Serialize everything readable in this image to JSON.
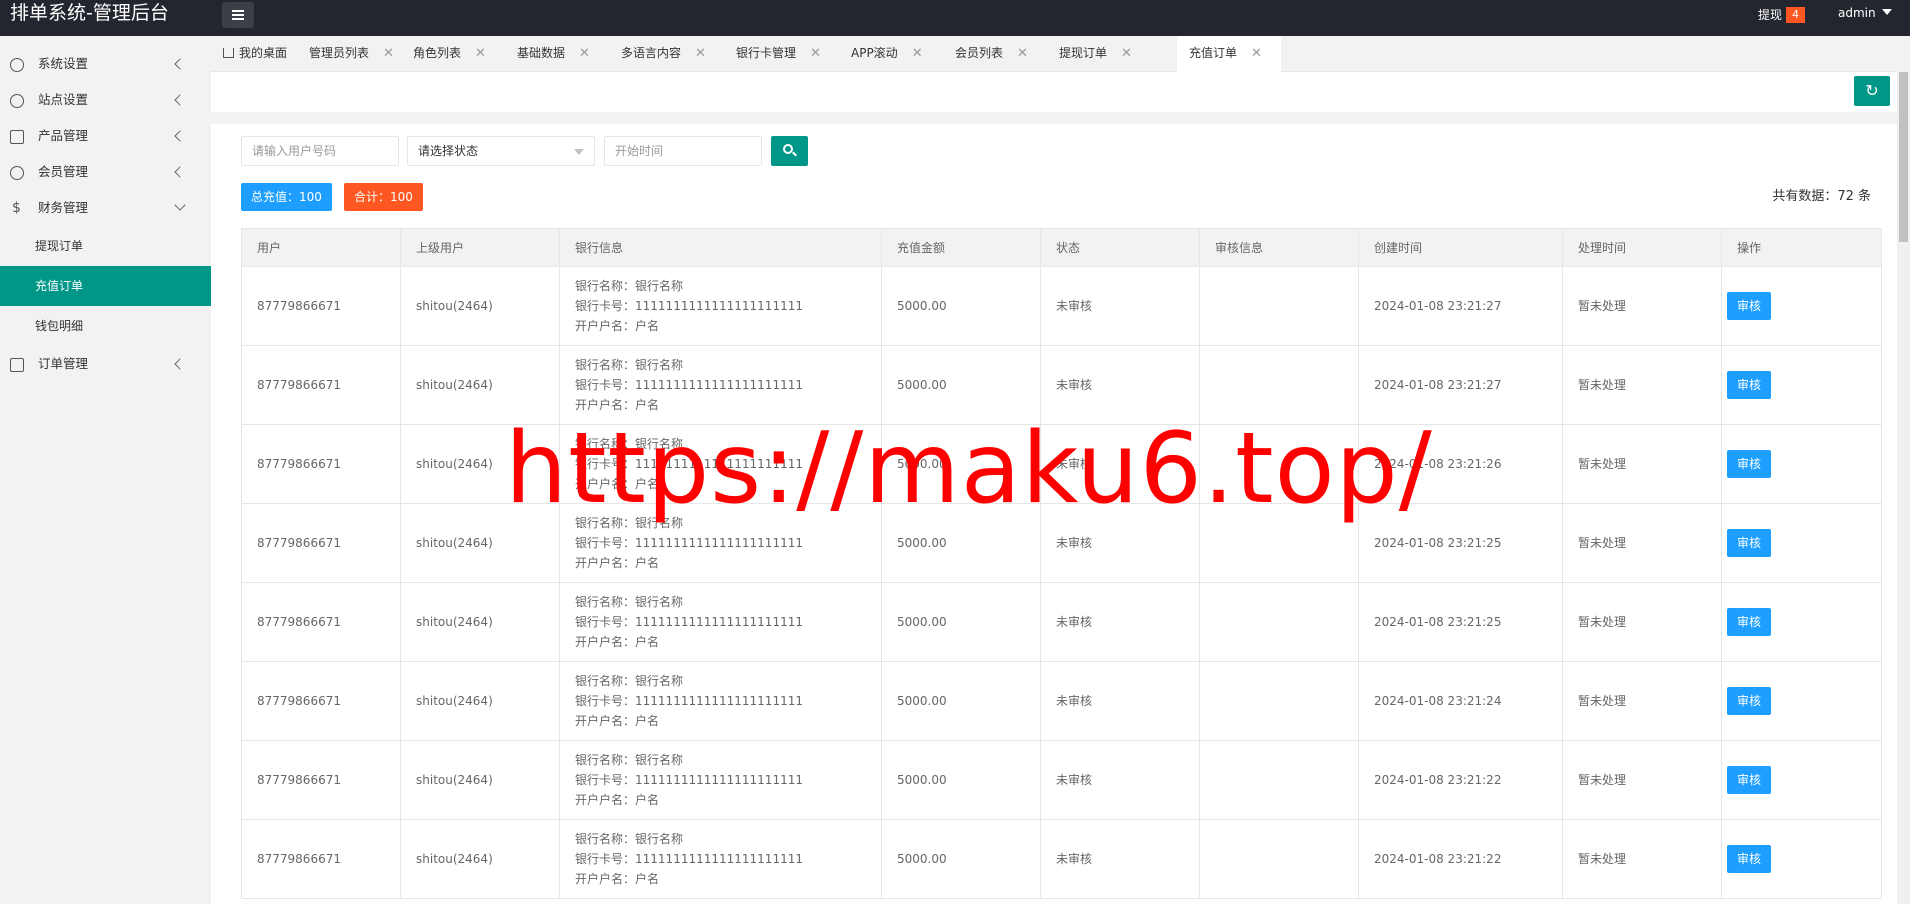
{
  "header": {
    "title": "排单系统-管理后台",
    "withdraw_label": "提现",
    "withdraw_count": "4",
    "user": "admin"
  },
  "sidebar": {
    "items": [
      {
        "label": "系统设置",
        "icon": "gear-icon"
      },
      {
        "label": "站点设置",
        "icon": "site-icon"
      },
      {
        "label": "产品管理",
        "icon": "product-icon"
      },
      {
        "label": "会员管理",
        "icon": "user-icon"
      },
      {
        "label": "财务管理",
        "icon": "dollar-icon"
      },
      {
        "label": "订单管理",
        "icon": "order-icon"
      }
    ],
    "sub_items": [
      "提现订单",
      "充值订单",
      "钱包明细"
    ]
  },
  "tabs": [
    "我的桌面",
    "管理员列表",
    "角色列表",
    "基础数据",
    "多语言内容",
    "银行卡管理",
    "APP滚动",
    "会员列表",
    "提现订单",
    "充值订单"
  ],
  "filters": {
    "user_placeholder": "请输入用户号码",
    "status_placeholder": "请选择状态",
    "start_time_placeholder": "开始时间"
  },
  "summary": {
    "total_recharge": "总充值：100",
    "sum": "合计：100",
    "count": "共有数据：72 条"
  },
  "table": {
    "headers": [
      "用户",
      "上级用户",
      "银行信息",
      "充值金额",
      "状态",
      "审核信息",
      "创建时间",
      "处理时间",
      "操作"
    ],
    "bank_labels": {
      "name": "银行名称：",
      "card": "银行卡号：",
      "holder": "开户户名："
    },
    "action_label": "审核",
    "rows": [
      {
        "user": "87779866671",
        "parent": "shitou(2464)",
        "bank_name": "银行名称",
        "card": "1111111111111111111111",
        "holder": "户名",
        "amount": "5000.00",
        "status": "未审核",
        "review": "",
        "created": "2024-01-08 23:21:27",
        "processed": "暂未处理"
      },
      {
        "user": "87779866671",
        "parent": "shitou(2464)",
        "bank_name": "银行名称",
        "card": "1111111111111111111111",
        "holder": "户名",
        "amount": "5000.00",
        "status": "未审核",
        "review": "",
        "created": "2024-01-08 23:21:27",
        "processed": "暂未处理"
      },
      {
        "user": "87779866671",
        "parent": "shitou(2464)",
        "bank_name": "银行名称",
        "card": "1111111111111111111111",
        "holder": "户名",
        "amount": "5000.00",
        "status": "未审核",
        "review": "",
        "created": "2024-01-08 23:21:26",
        "processed": "暂未处理"
      },
      {
        "user": "87779866671",
        "parent": "shitou(2464)",
        "bank_name": "银行名称",
        "card": "1111111111111111111111",
        "holder": "户名",
        "amount": "5000.00",
        "status": "未审核",
        "review": "",
        "created": "2024-01-08 23:21:25",
        "processed": "暂未处理"
      },
      {
        "user": "87779866671",
        "parent": "shitou(2464)",
        "bank_name": "银行名称",
        "card": "1111111111111111111111",
        "holder": "户名",
        "amount": "5000.00",
        "status": "未审核",
        "review": "",
        "created": "2024-01-08 23:21:25",
        "processed": "暂未处理"
      },
      {
        "user": "87779866671",
        "parent": "shitou(2464)",
        "bank_name": "银行名称",
        "card": "1111111111111111111111",
        "holder": "户名",
        "amount": "5000.00",
        "status": "未审核",
        "review": "",
        "created": "2024-01-08 23:21:24",
        "processed": "暂未处理"
      },
      {
        "user": "87779866671",
        "parent": "shitou(2464)",
        "bank_name": "银行名称",
        "card": "1111111111111111111111",
        "holder": "户名",
        "amount": "5000.00",
        "status": "未审核",
        "review": "",
        "created": "2024-01-08 23:21:22",
        "processed": "暂未处理"
      },
      {
        "user": "87779866671",
        "parent": "shitou(2464)",
        "bank_name": "银行名称",
        "card": "1111111111111111111111",
        "holder": "户名",
        "amount": "5000.00",
        "status": "未审核",
        "review": "",
        "created": "2024-01-08 23:21:22",
        "processed": "暂未处理"
      }
    ]
  },
  "watermark": "https://maku6.top/",
  "colors": {
    "primary": "#009688",
    "accent": "#ff5722",
    "info": "#1e9fff",
    "header_bg": "#23262e",
    "watermark": "#ff0000"
  }
}
